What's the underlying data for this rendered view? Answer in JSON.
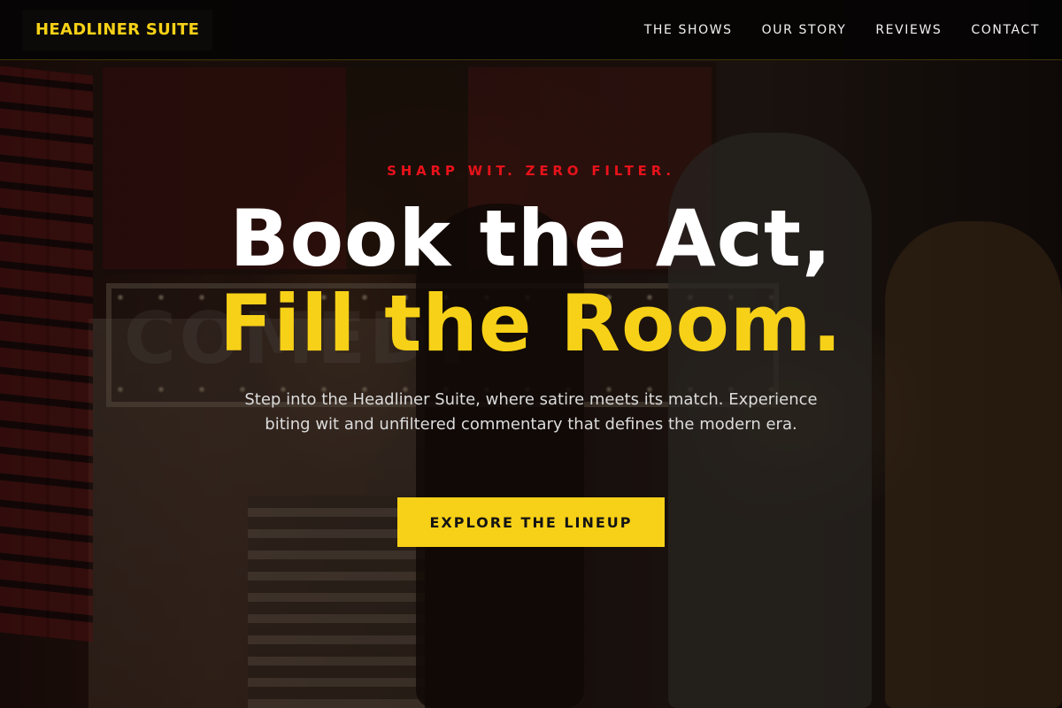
{
  "brand": {
    "name": "HEADLINER SUITE",
    "color": "#f7d117"
  },
  "nav": {
    "items": [
      {
        "label": "THE SHOWS"
      },
      {
        "label": "OUR STORY"
      },
      {
        "label": "REVIEWS"
      },
      {
        "label": "CONTACT"
      }
    ]
  },
  "hero": {
    "tagline": "SHARP WIT. ZERO FILTER.",
    "headline_line1": "Book the Act,",
    "headline_line2": "Fill the Room.",
    "description": "Step into the Headliner Suite, where satire meets its match. Experience biting wit and unfiltered commentary that defines the modern era.",
    "cta_label": "EXPLORE THE LINEUP",
    "background_image": "comedy-club-entrance-photo",
    "marquee_text": "COMEDY"
  },
  "colors": {
    "accent": "#f7d117",
    "tagline": "#e8121a",
    "nav_background": "#050404",
    "text_primary": "#ffffff"
  }
}
